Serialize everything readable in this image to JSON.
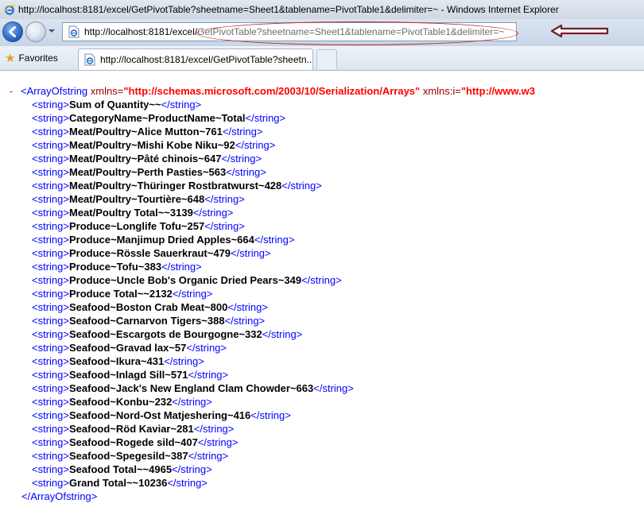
{
  "window": {
    "title": "http://localhost:8181/excel/GetPivotTable?sheetname=Sheet1&tablename=PivotTable1&delimiter=~ - Windows Internet Explorer"
  },
  "address_bar": {
    "url_host": "http://localhost:8181/excel/",
    "url_path": "GetPivotTable?sheetname=Sheet1&tablename=PivotTable1&delimiter=~"
  },
  "tabs_bar": {
    "favorites_label": "Favorites",
    "active_tab_label": "http://localhost:8181/excel/GetPivotTable?sheetn..."
  },
  "xml": {
    "collapse_symbol": "-",
    "root_open_tag": "<ArrayOfstring",
    "root_attr1_name": "xmlns=",
    "root_attr1_value": "\"http://schemas.microsoft.com/2003/10/Serialization/Arrays\"",
    "root_attr2_name": "xmlns:i=",
    "root_attr2_value": "\"http://www.w3",
    "root_close_tag": "</ArrayOfstring>",
    "item_open_tag": "<string>",
    "item_close_tag": "</string>",
    "items": [
      "Sum of Quantity~~",
      "CategoryName~ProductName~Total",
      "Meat/Poultry~Alice Mutton~761",
      "Meat/Poultry~Mishi Kobe Niku~92",
      "Meat/Poultry~Pâté chinois~647",
      "Meat/Poultry~Perth Pasties~563",
      "Meat/Poultry~Thüringer Rostbratwurst~428",
      "Meat/Poultry~Tourtière~648",
      "Meat/Poultry Total~~3139",
      "Produce~Longlife Tofu~257",
      "Produce~Manjimup Dried Apples~664",
      "Produce~Rössle Sauerkraut~479",
      "Produce~Tofu~383",
      "Produce~Uncle Bob's Organic Dried Pears~349",
      "Produce Total~~2132",
      "Seafood~Boston Crab Meat~800",
      "Seafood~Carnarvon Tigers~388",
      "Seafood~Escargots de Bourgogne~332",
      "Seafood~Gravad lax~57",
      "Seafood~Ikura~431",
      "Seafood~Inlagd Sill~571",
      "Seafood~Jack's New England Clam Chowder~663",
      "Seafood~Konbu~232",
      "Seafood~Nord-Ost Matjeshering~416",
      "Seafood~Röd Kaviar~281",
      "Seafood~Rogede sild~407",
      "Seafood~Spegesild~387",
      "Seafood Total~~4965",
      "Grand Total~~10236"
    ]
  },
  "colors": {
    "tag": "#0000ff",
    "attr_name": "#990000",
    "attr_value": "#ff0000",
    "annotation": "#c0282c",
    "arrow": "#7a1b2a"
  },
  "icons": {
    "browser": "ie-logo-icon",
    "page": "ie-page-icon",
    "favorites": "star-icon",
    "annotation": "arrow-left-icon"
  }
}
